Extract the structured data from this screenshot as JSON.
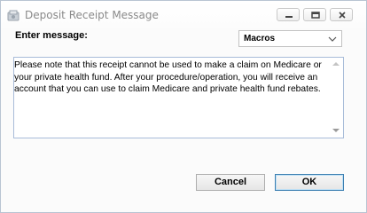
{
  "window": {
    "title": "Deposit Receipt Message"
  },
  "titlebar_buttons": {
    "minimize_icon": "minimize-icon",
    "restore_icon": "restore-icon",
    "close_icon": "close-icon"
  },
  "form": {
    "label": "Enter message:",
    "macros_select": "Macros",
    "message": "Please note that this receipt cannot be used to make a claim on Medicare or your private health fund. After your procedure/operation, you will receive an account that you can use to claim Medicare and private health fund rebates."
  },
  "buttons": {
    "cancel": "Cancel",
    "ok": "OK"
  }
}
